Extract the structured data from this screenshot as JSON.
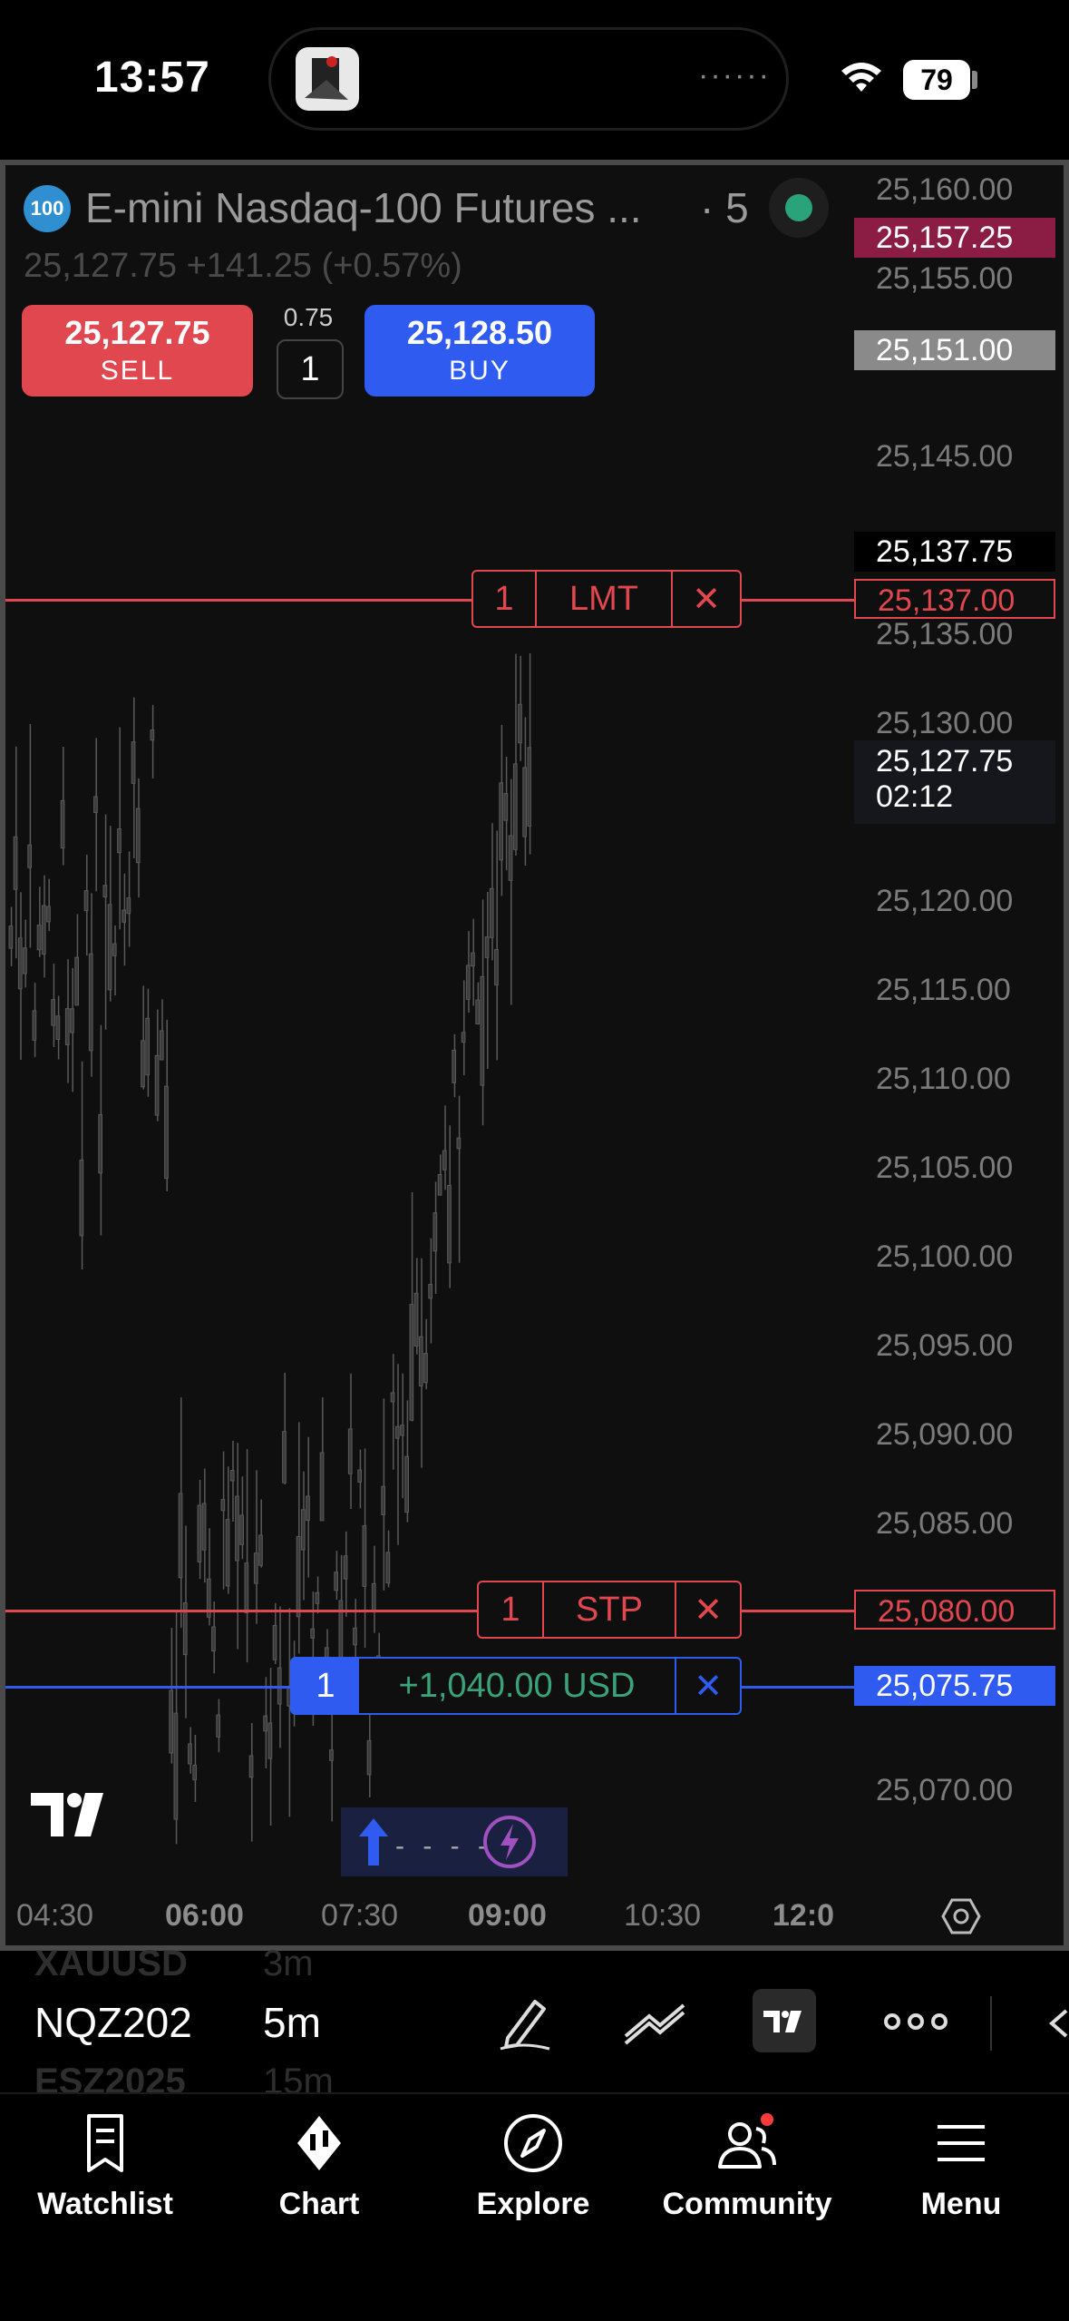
{
  "status_bar": {
    "time": "13:57",
    "battery": "79"
  },
  "symbol": {
    "badge": "100",
    "name": "E-mini Nasdaq-100 Futures ...",
    "interval": "· 5",
    "price_line": "25,127.75 +141.25 (+0.57%)"
  },
  "trade": {
    "sell_price": "25,127.75",
    "sell_label": "SELL",
    "buy_price": "25,128.50",
    "buy_label": "BUY",
    "spread": "0.75",
    "quantity": "1"
  },
  "price_axis": {
    "ticks": [
      "25,160.00",
      "25,155.00",
      "25,145.00",
      "25,135.00",
      "25,130.00",
      "25,120.00",
      "25,115.00",
      "25,110.00",
      "25,105.00",
      "25,100.00",
      "25,095.00",
      "25,090.00",
      "25,085.00",
      "25,070.00"
    ],
    "high_tag": "25,157.25",
    "grey_tag": "25,151.00",
    "black_tag": "25,137.75",
    "limit_tag": "25,137.00",
    "last_price": "25,127.75",
    "countdown": "02:12",
    "stop_tag": "25,080.00",
    "position_tag": "25,075.75"
  },
  "orders": {
    "limit": {
      "qty": "1",
      "type": "LMT",
      "close": "✕"
    },
    "stop": {
      "qty": "1",
      "type": "STP",
      "close": "✕"
    },
    "position": {
      "qty": "1",
      "pnl": "+1,040.00 USD",
      "close": "✕"
    }
  },
  "time_axis": [
    "04:30",
    "06:00",
    "07:30",
    "09:00",
    "10:30",
    "12:0"
  ],
  "colors": {
    "sell": "#e0474f",
    "buy": "#2f5bf0",
    "limit_line": "#e0474f",
    "position_line": "#2f5bf0",
    "pnl_text": "#3aa37a",
    "high_tag": "#8b1d44"
  },
  "toolbar": {
    "symbol": "NQZ202",
    "interval": "5m",
    "ghost_above_symbol": "XAUUSD",
    "ghost_above_interval": "3m",
    "ghost_below_symbol": "ESZ2025",
    "ghost_below_interval": "15m"
  },
  "nav": [
    {
      "label": "Watchlist",
      "icon": "watchlist-icon"
    },
    {
      "label": "Chart",
      "icon": "chart-icon"
    },
    {
      "label": "Explore",
      "icon": "compass-icon"
    },
    {
      "label": "Community",
      "icon": "community-icon"
    },
    {
      "label": "Menu",
      "icon": "menu-icon"
    }
  ]
}
